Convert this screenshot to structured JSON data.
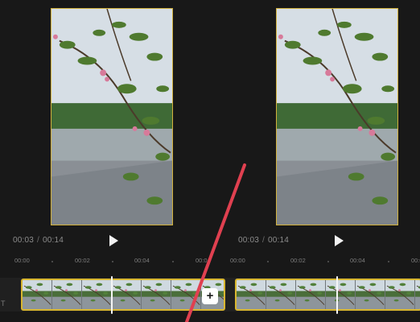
{
  "left_editor": {
    "current_time": "00:03",
    "separator": "/",
    "total_time": "00:14",
    "ruler_labels": [
      "00:00",
      "00:02",
      "00:04",
      "00:0"
    ]
  },
  "right_editor": {
    "current_time": "00:03",
    "separator": "/",
    "total_time": "00:14",
    "ruler_labels": [
      "00:00",
      "00:02",
      "00:04",
      "00:0"
    ]
  },
  "timeline": {
    "add_clip_label": "+",
    "side_glyph": "T"
  },
  "colors": {
    "clip_border": "#d8b630",
    "preview_border": "#d2b13c",
    "annotation_stroke": "#e04050"
  },
  "icons": {
    "play": "play-icon",
    "add": "plus-icon"
  }
}
